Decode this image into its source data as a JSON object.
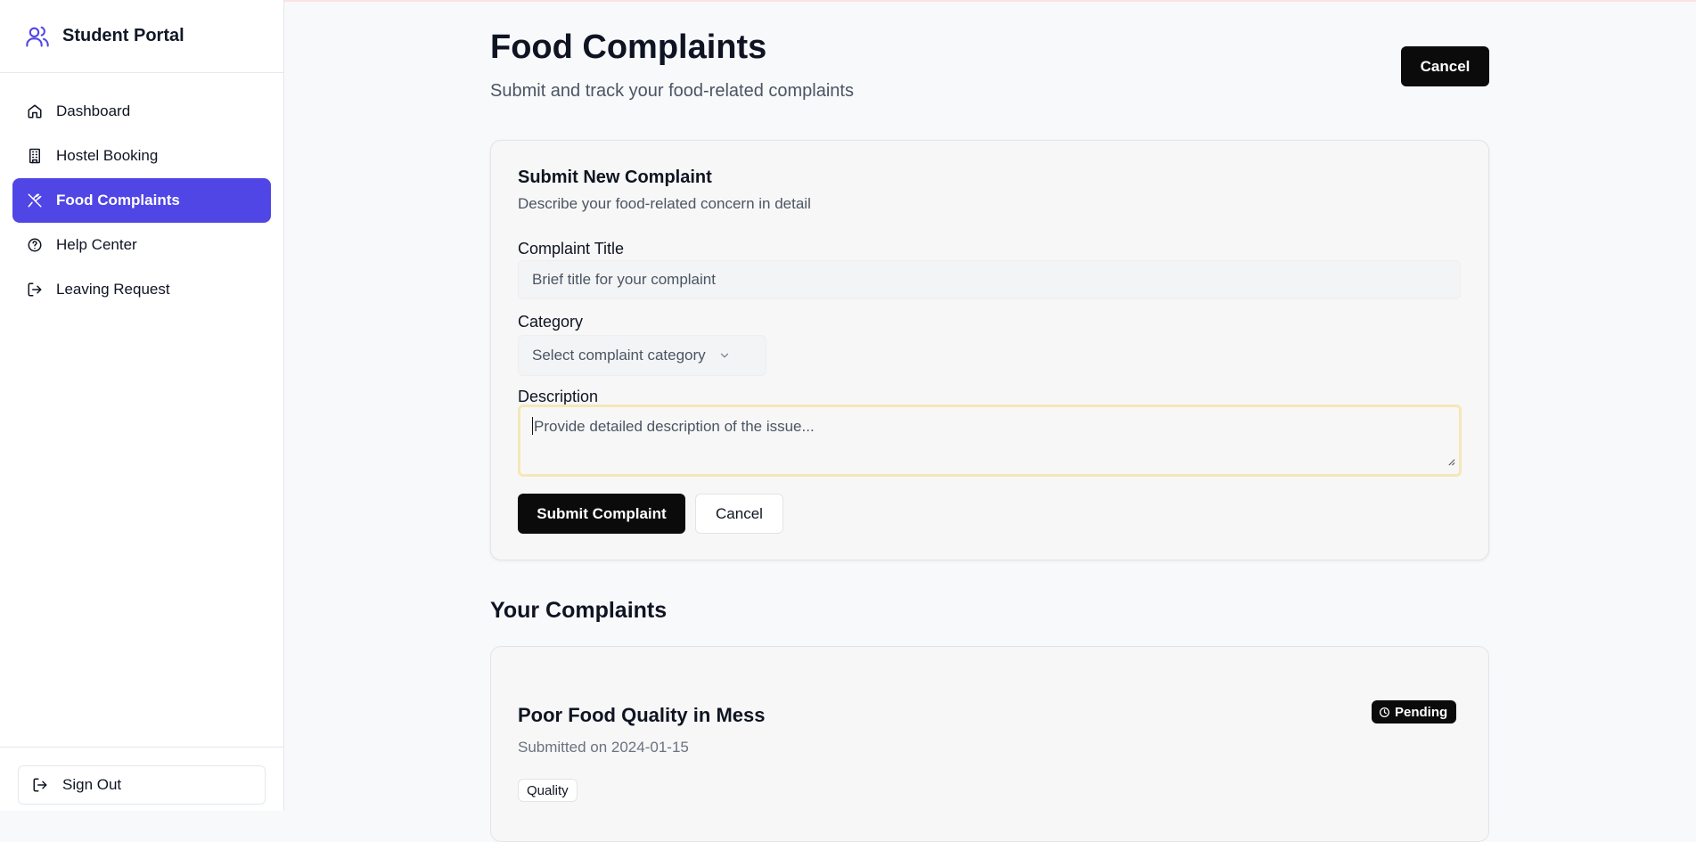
{
  "app": {
    "title": "Student Portal",
    "accent": "#4f46e5"
  },
  "sidebar": {
    "items": [
      {
        "label": "Dashboard",
        "icon": "home-icon"
      },
      {
        "label": "Hostel Booking",
        "icon": "building-icon"
      },
      {
        "label": "Food Complaints",
        "icon": "utensils-icon",
        "active": true
      },
      {
        "label": "Help Center",
        "icon": "help-circle-icon"
      },
      {
        "label": "Leaving Request",
        "icon": "log-out-icon"
      }
    ],
    "sign_out": "Sign Out"
  },
  "header": {
    "title": "Food Complaints",
    "subtitle": "Submit and track your food-related complaints",
    "cancel_label": "Cancel"
  },
  "form": {
    "title": "Submit New Complaint",
    "description": "Describe your food-related concern in detail",
    "title_label": "Complaint Title",
    "title_placeholder": "Brief title for your complaint",
    "category_label": "Category",
    "category_placeholder": "Select complaint category",
    "description_label": "Description",
    "description_placeholder": "Provide detailed description of the issue...",
    "submit_label": "Submit Complaint",
    "cancel_label": "Cancel"
  },
  "complaints": {
    "section_title": "Your Complaints",
    "items": [
      {
        "title": "Poor Food Quality in Mess",
        "submitted": "Submitted on 2024-01-15",
        "status": "Pending",
        "category": "Quality"
      }
    ]
  }
}
